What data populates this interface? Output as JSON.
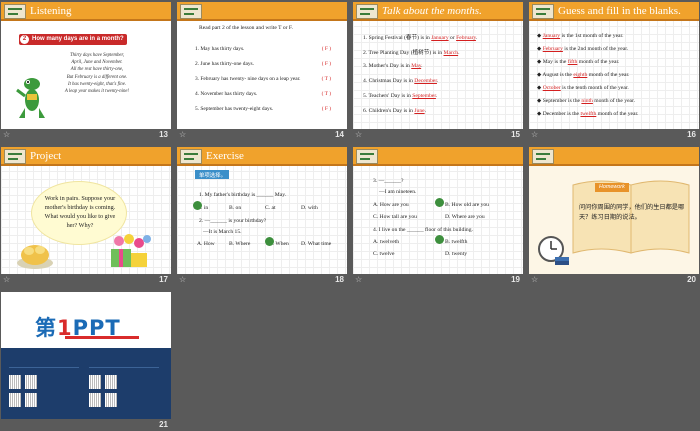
{
  "slides": [
    {
      "number": "21",
      "id": "s21"
    }
  ],
  "s13": {
    "number": "13",
    "title": "Listening",
    "question_number": "2",
    "question": "How many days are in a month?",
    "poem": [
      "Thirty days have September,",
      "April, June and November.",
      "All the rest have thirty-one,",
      "But February is a different one.",
      "It has twenty-eight, that's fine.",
      "A leap year makes it twenty-nine!"
    ]
  },
  "s14": {
    "number": "14",
    "instruction": "Read part 2 of the lesson and write T or F.",
    "rows": [
      {
        "text": "1. May has thirty days.",
        "answer": "( F )"
      },
      {
        "text": "2. June has thirty-one days.",
        "answer": "( F )"
      },
      {
        "text": "3. February has twenty- nine days on a leap year.",
        "answer": "( T )"
      },
      {
        "text": "4. November has thirty days.",
        "answer": "( T )"
      },
      {
        "text": "5. September has twenty-eight days.",
        "answer": "( F )"
      }
    ]
  },
  "s15": {
    "number": "15",
    "title": "Talk about the months.",
    "lines": [
      {
        "pre": "1.  Spring  Festival (春节) is in ",
        "a": "January",
        "mid": " or ",
        "b": "February",
        "post": "."
      },
      {
        "pre": "2.  Tree Planting Day (植树节) is in ",
        "a": "March",
        "mid": "",
        "b": "",
        "post": "."
      },
      {
        "pre": "3.  Mother's Day is in ",
        "a": "May",
        "mid": "",
        "b": "",
        "post": "."
      },
      {
        "pre": "4.  Christmas Day is in ",
        "a": "December",
        "mid": "",
        "b": "",
        "post": "."
      },
      {
        "pre": "5.  Teachers' Day is in ",
        "a": "September",
        "mid": "",
        "b": "",
        "post": "."
      },
      {
        "pre": "6.  Children's Day is in ",
        "a": "June",
        "mid": "",
        "b": "",
        "post": "."
      }
    ]
  },
  "s16": {
    "number": "16",
    "title": "Guess and fill in the blanks.",
    "lines": [
      {
        "pre": "◆  ",
        "a": "January",
        "post": "  is the 1st month of the year."
      },
      {
        "pre": "◆  ",
        "a": "February",
        "post": " is the 2nd month of the year."
      },
      {
        "pre": "◆  May is the ",
        "a": "fifth",
        "post": " month of the year."
      },
      {
        "pre": "◆  August is the ",
        "a": "eighth",
        "post": " month of the year."
      },
      {
        "pre": "◆  ",
        "a": "October",
        "post": " is the tenth month of the year."
      },
      {
        "pre": "◆  September is the ",
        "a": "ninth",
        "post": " month of the year."
      },
      {
        "pre": "◆  December is the ",
        "a": "twelfth",
        "post": " month of the year."
      }
    ]
  },
  "s17": {
    "number": "17",
    "title": "Project",
    "bubble": "Work in pairs. Suppose your mother's birthday is coming. What would you like to give her? Why?"
  },
  "s18": {
    "number": "18",
    "title": "Exercise",
    "tag": "单项选择。",
    "q1": "1. My father's birthday is ______ May.",
    "q1_opts": [
      "A. in",
      "B. on",
      "C. at",
      "D. with"
    ],
    "q2a": "2. —______ is your birthday?",
    "q2b": "—It is March 15.",
    "q2_opts": [
      "A. How",
      "B. Where",
      "C. When",
      "D. What time"
    ]
  },
  "s19": {
    "number": "19",
    "q3a": "3. —______?",
    "q3b": "—I am nineteen.",
    "q3_opts": [
      "A. How are you",
      "B. How old are you",
      "C. How tall are you",
      "D. Where are you"
    ],
    "q4": "4. I live on the ______ floor of this building.",
    "q4_opts": [
      "A. twelveth",
      "B. twelfth",
      "C. twelve",
      "D. twenty"
    ]
  },
  "s20": {
    "number": "20",
    "tag": "Homework",
    "text": "问问你周围的同学，他们的生日都是哪天？练习日期的说法。"
  },
  "s21": {
    "number": "21",
    "logo_a": "第",
    "logo_one": "1",
    "logo_b": "PPT"
  },
  "colors": {
    "header": "#f0a22c",
    "answer_red": "#d41f1f",
    "background": "#5a5a5a",
    "exercise_blue": "#3b8fc9"
  }
}
